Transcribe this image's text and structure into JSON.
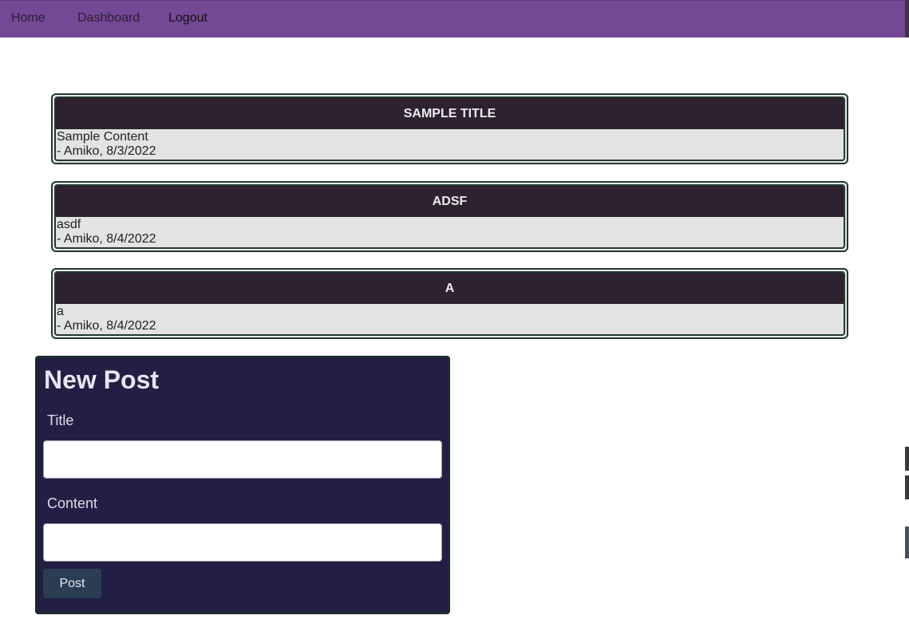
{
  "nav": {
    "home_label": "Home",
    "dashboard_label": "Dashboard",
    "logout_label": "Logout"
  },
  "posts": [
    {
      "title": "Sample Title",
      "content": "Sample Content",
      "byline": "- Amiko, 8/3/2022"
    },
    {
      "title": "adsf",
      "content": "asdf",
      "byline": "- Amiko, 8/4/2022"
    },
    {
      "title": "a",
      "content": "a",
      "byline": "- Amiko, 8/4/2022"
    }
  ],
  "new_post": {
    "heading": "New Post",
    "title_label": "Title",
    "title_value": "",
    "content_label": "Content",
    "content_value": "",
    "submit_label": "Post"
  },
  "colors": {
    "navbar": "#734895",
    "card_header": "#2e2231",
    "card_body": "#e3e3e3",
    "form_panel": "#221e44",
    "button": "#2b3d52"
  }
}
